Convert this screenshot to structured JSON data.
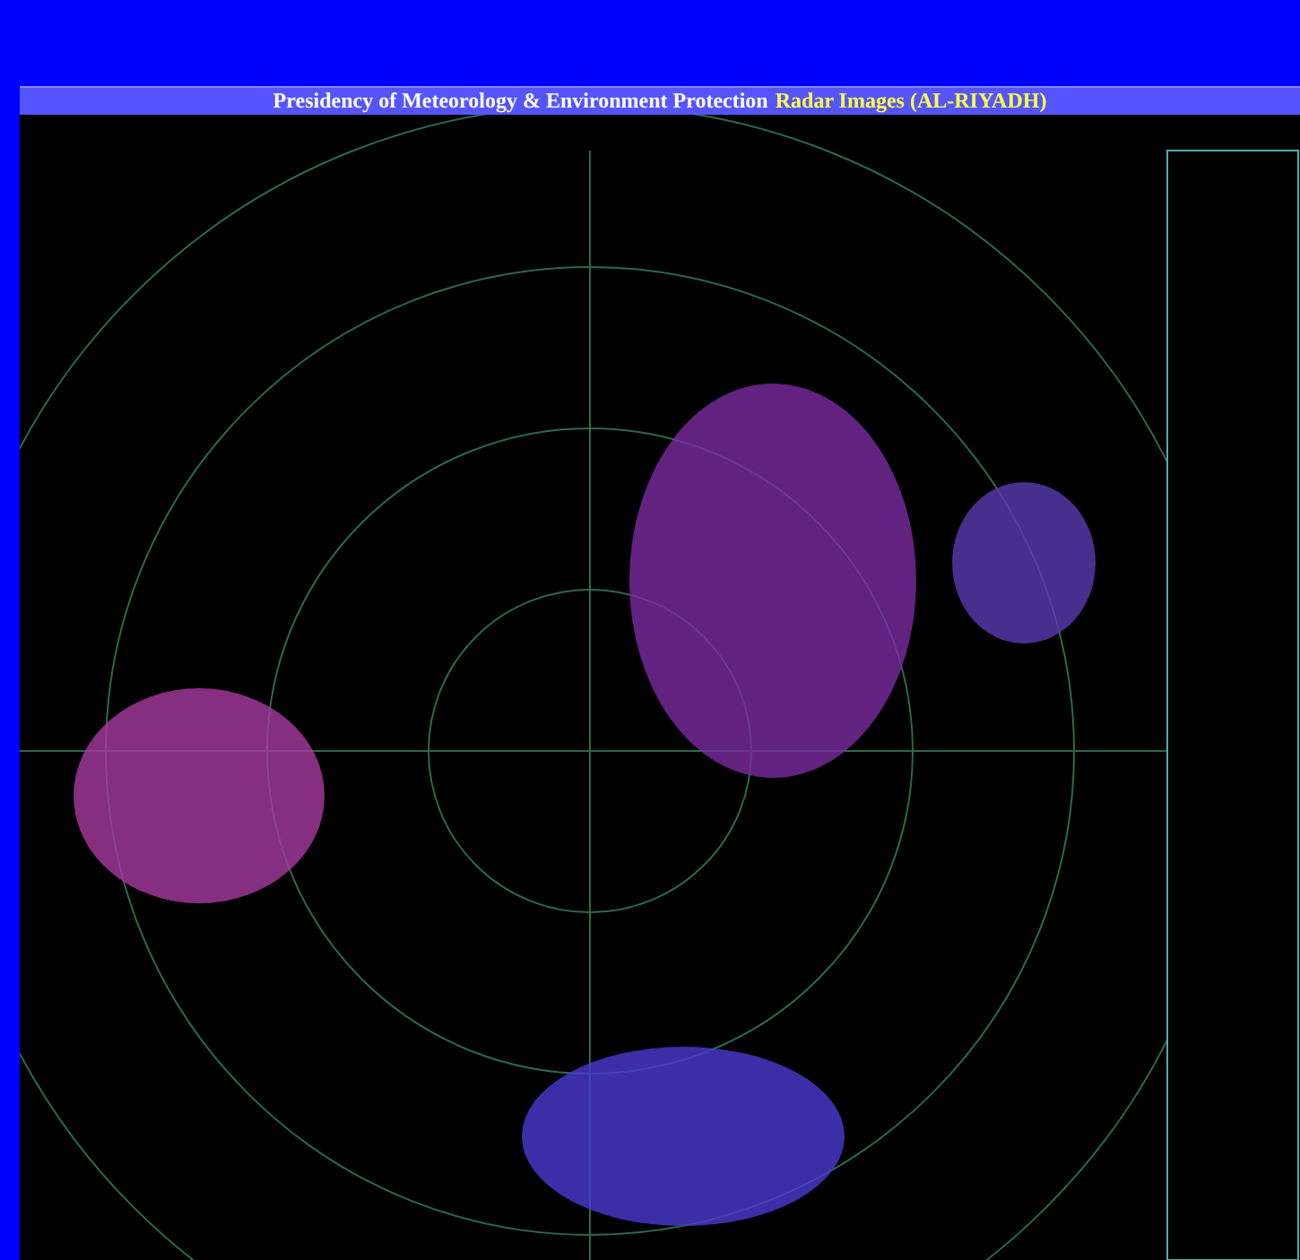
{
  "header": {
    "title": "Presidency of Meteorology & Environment Protection",
    "subtitle": "Radar Images (AL-RIYADH)"
  },
  "radar_image": {
    "kind": "radar"
  }
}
